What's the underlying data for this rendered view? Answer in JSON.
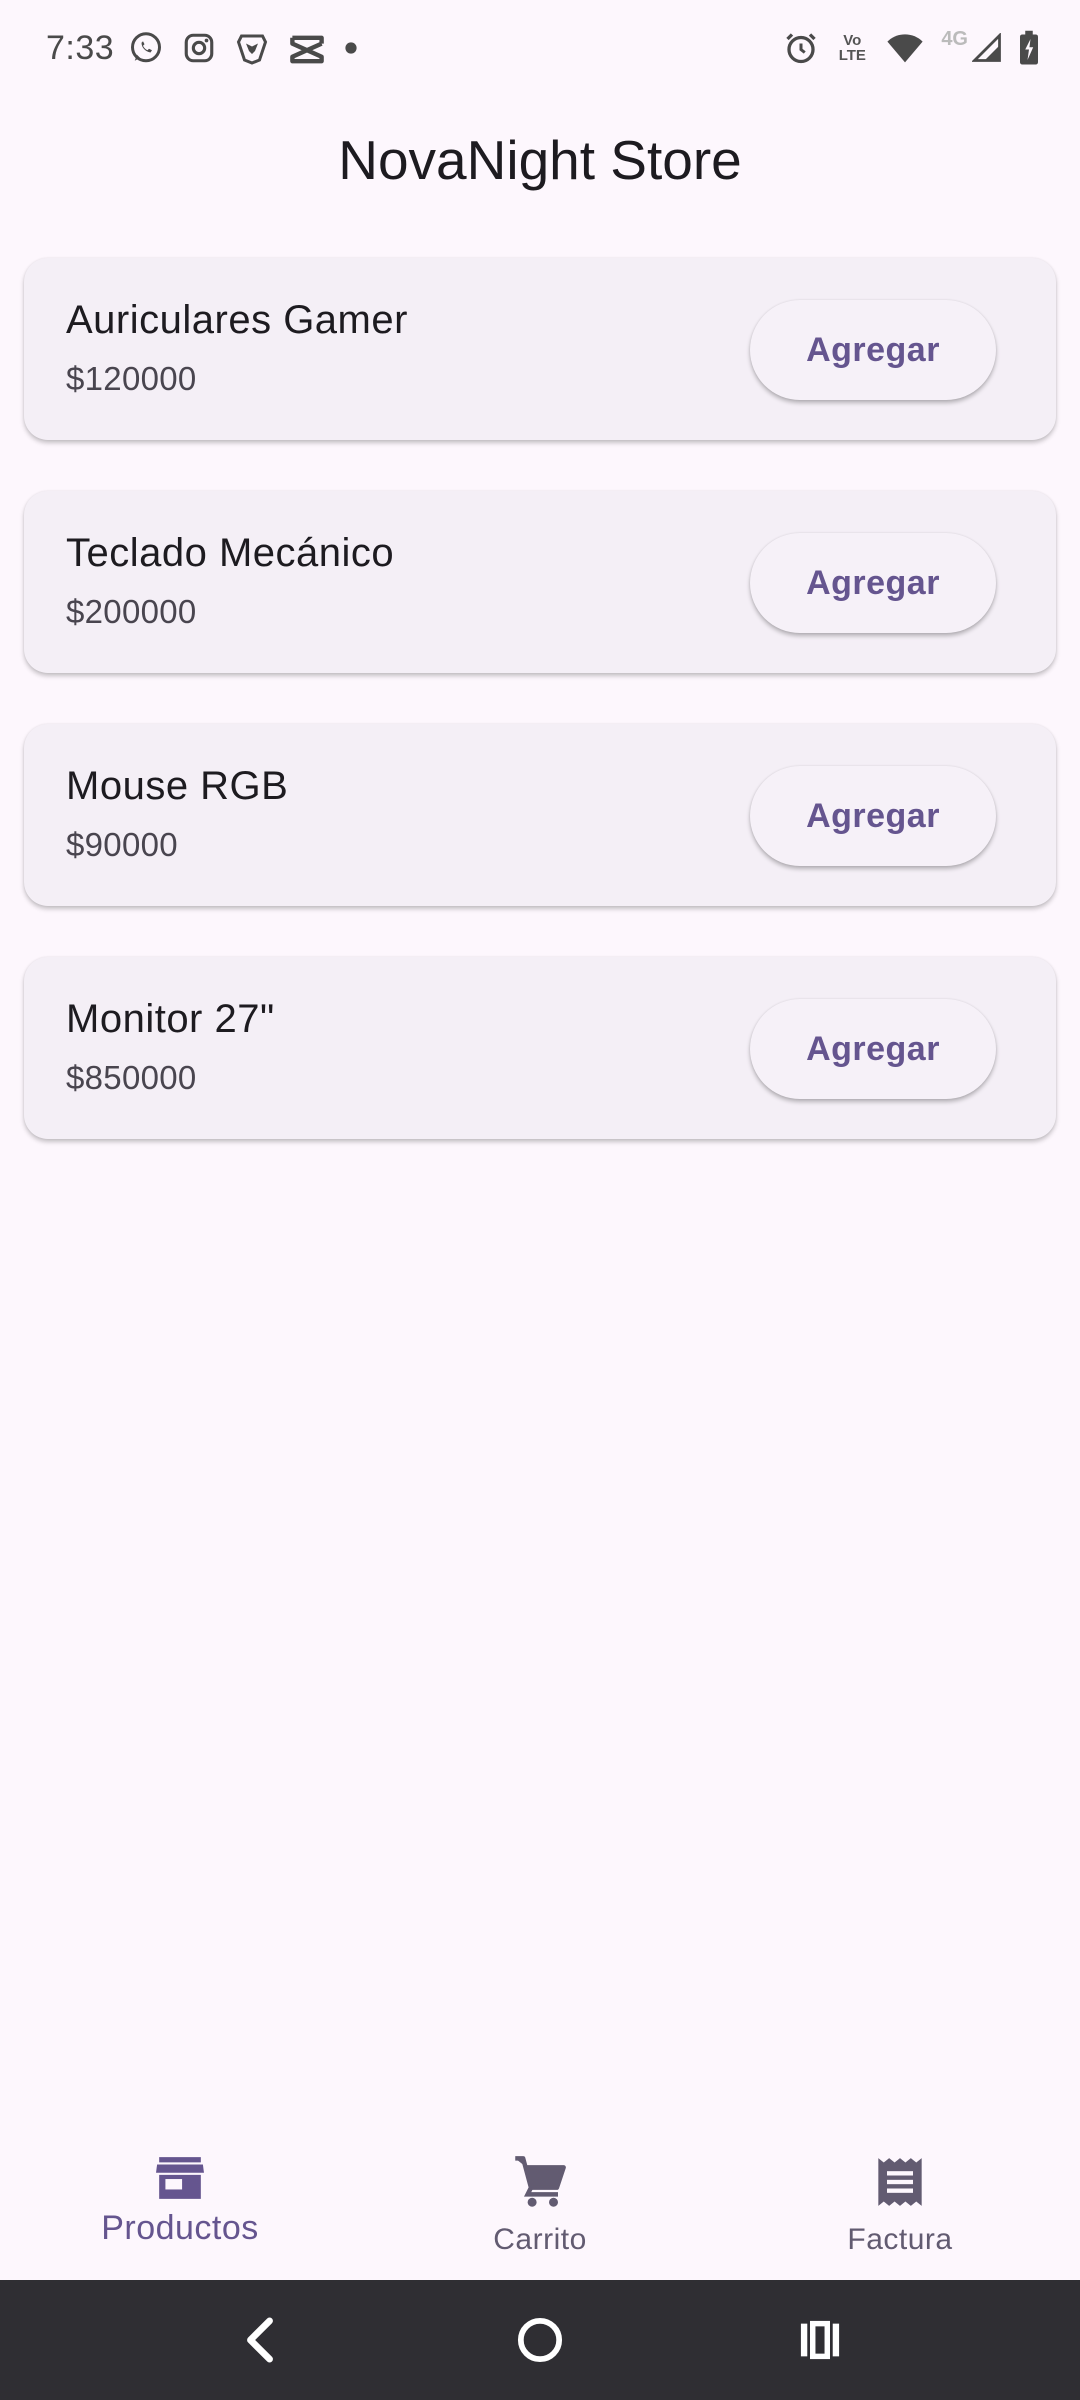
{
  "status_bar": {
    "time": "7:33",
    "left_icons": [
      "whatsapp-icon",
      "instagram-icon",
      "brave-icon",
      "capcut-icon",
      "dot-icon"
    ],
    "lte_label": "Vo LTE",
    "network_label": "4G",
    "right_icons": [
      "alarm-icon",
      "volte-icon",
      "wifi-icon",
      "signal-icon",
      "battery-icon"
    ]
  },
  "app": {
    "title": "NovaNight Store"
  },
  "products": [
    {
      "name": "Auriculares Gamer",
      "price": "$120000",
      "button": "Agregar"
    },
    {
      "name": "Teclado Mecánico",
      "price": "$200000",
      "button": "Agregar"
    },
    {
      "name": "Mouse RGB",
      "price": "$90000",
      "button": "Agregar"
    },
    {
      "name": "Monitor 27\"",
      "price": "$850000",
      "button": "Agregar"
    }
  ],
  "bottom_nav": {
    "items": [
      {
        "label": "Productos",
        "icon": "store-icon",
        "active": true
      },
      {
        "label": "Carrito",
        "icon": "cart-icon",
        "active": false
      },
      {
        "label": "Factura",
        "icon": "receipt-icon",
        "active": false
      }
    ]
  },
  "system_nav": [
    "back-icon",
    "home-icon",
    "recents-icon"
  ],
  "colors": {
    "background": "#fdf7fd",
    "card": "#f4eff6",
    "accent": "#65558f",
    "text_primary": "#1d1b20",
    "text_secondary": "#49454f",
    "system_bar": "#2f2e33"
  }
}
